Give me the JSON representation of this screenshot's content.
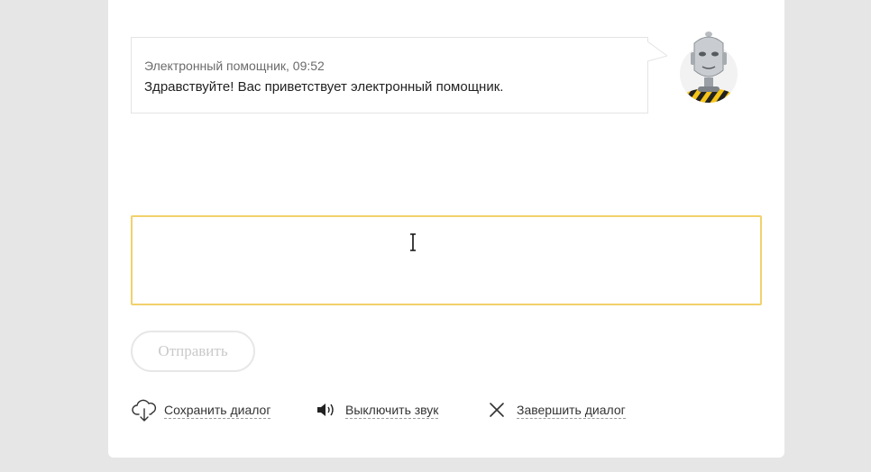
{
  "chat": {
    "messages": [
      {
        "author": "Электронный помощник, 09:52",
        "text": "Здравствуйте! Вас приветствует электронный помощник."
      }
    ]
  },
  "input": {
    "value": "",
    "placeholder": ""
  },
  "send_button": {
    "label": "Отправить"
  },
  "actions": {
    "save_label": "Сохранить диалог",
    "mute_label": "Выключить звук",
    "end_label": "Завершить диалог"
  },
  "icons": {
    "save": "cloud-download-icon",
    "mute": "speaker-icon",
    "end": "close-icon",
    "assistant": "robot-avatar"
  },
  "colors": {
    "accent_border": "#f2d16b",
    "avatar_stripe_dark": "#222222",
    "avatar_stripe_yellow": "#f5c518"
  }
}
